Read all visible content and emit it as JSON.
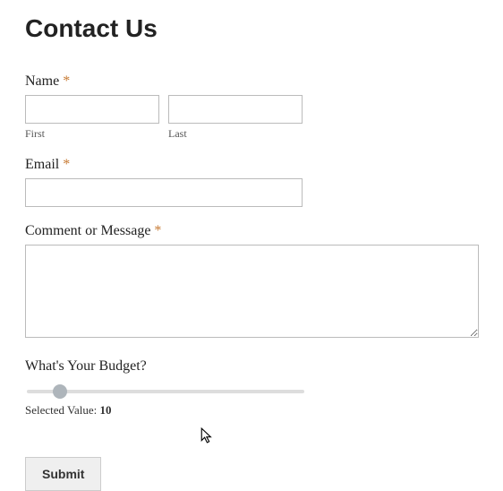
{
  "title": "Contact Us",
  "required_marker": "*",
  "fields": {
    "name": {
      "label": "Name",
      "first_sublabel": "First",
      "last_sublabel": "Last",
      "first_value": "",
      "last_value": ""
    },
    "email": {
      "label": "Email",
      "value": ""
    },
    "message": {
      "label": "Comment or Message",
      "value": ""
    },
    "budget": {
      "label": "What's Your Budget?",
      "selected_prefix": "Selected Value: ",
      "value": "10"
    }
  },
  "submit_label": "Submit"
}
